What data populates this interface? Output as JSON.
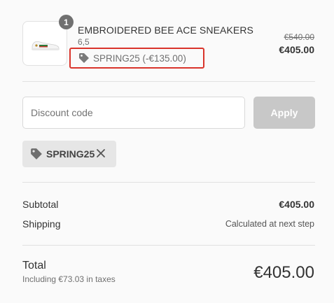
{
  "product": {
    "quantity": "1",
    "name": "EMBROIDERED BEE ACE SNEAKERS",
    "variant": "6,5",
    "discount_label": "SPRING25 (-€135.00)",
    "original_price": "€540.00",
    "price": "€405.00",
    "image_icon": "sneaker-icon"
  },
  "discount_form": {
    "placeholder": "Discount code",
    "apply_label": "Apply"
  },
  "applied_discount": {
    "code": "SPRING25",
    "tag_icon": "price-tag-icon",
    "remove_icon": "close-icon"
  },
  "summary": {
    "subtotal_label": "Subtotal",
    "subtotal_value": "€405.00",
    "shipping_label": "Shipping",
    "shipping_value": "Calculated at next step"
  },
  "total": {
    "label": "Total",
    "taxes_note": "Including €73.03 in taxes",
    "amount": "€405.00"
  },
  "colors": {
    "highlight_border": "#d9342b",
    "apply_button_disabled": "#c8c8c8",
    "tag_background": "#e6e6e6"
  }
}
